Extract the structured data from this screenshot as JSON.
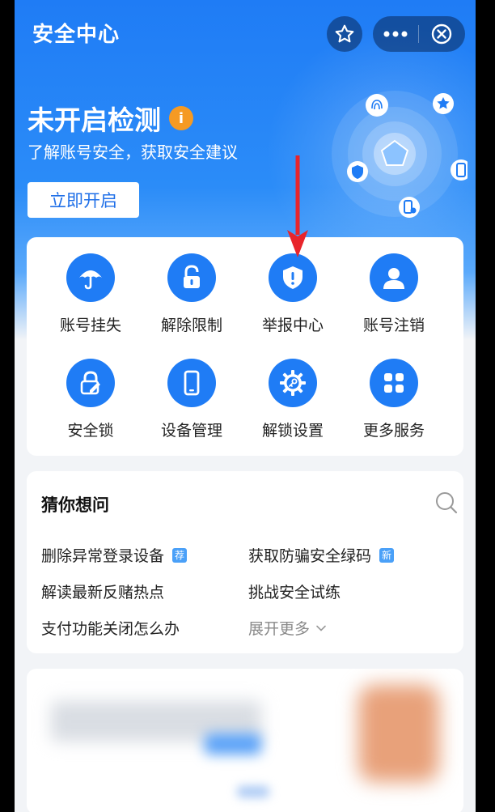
{
  "header": {
    "title": "安全中心",
    "favorite_icon": "star-icon",
    "more_icon": "more-dots-icon",
    "close_icon": "close-circle-icon"
  },
  "hero": {
    "status_title": "未开启检测",
    "info_badge": "i",
    "subtitle": "了解账号安全，获取安全建议",
    "enable_button": "立即开启",
    "radar_icons": [
      "fingerprint-icon",
      "star-icon",
      "shield-icon",
      "phone-icon",
      "device-lock-icon"
    ]
  },
  "services": [
    {
      "label": "账号挂失",
      "icon": "umbrella-icon"
    },
    {
      "label": "解除限制",
      "icon": "unlock-icon"
    },
    {
      "label": "举报中心",
      "icon": "report-shield-icon"
    },
    {
      "label": "账号注销",
      "icon": "user-icon"
    },
    {
      "label": "安全锁",
      "icon": "lock-edit-icon"
    },
    {
      "label": "设备管理",
      "icon": "phone-icon"
    },
    {
      "label": "解锁设置",
      "icon": "gear-key-icon"
    },
    {
      "label": "更多服务",
      "icon": "grid-icon"
    }
  ],
  "faq": {
    "title": "猜你想问",
    "search_icon": "search-icon",
    "items": [
      {
        "text": "删除异常登录设备",
        "tag": "荐"
      },
      {
        "text": "获取防骗安全绿码",
        "tag": "新"
      },
      {
        "text": "解读最新反赌热点",
        "tag": ""
      },
      {
        "text": "挑战安全试练",
        "tag": ""
      },
      {
        "text": "支付功能关闭怎么办",
        "tag": ""
      }
    ],
    "expand_label": "展开更多"
  },
  "colors": {
    "accent": "#1f7cf5",
    "badge": "#f59a23",
    "annotation_arrow": "#e8252b"
  }
}
